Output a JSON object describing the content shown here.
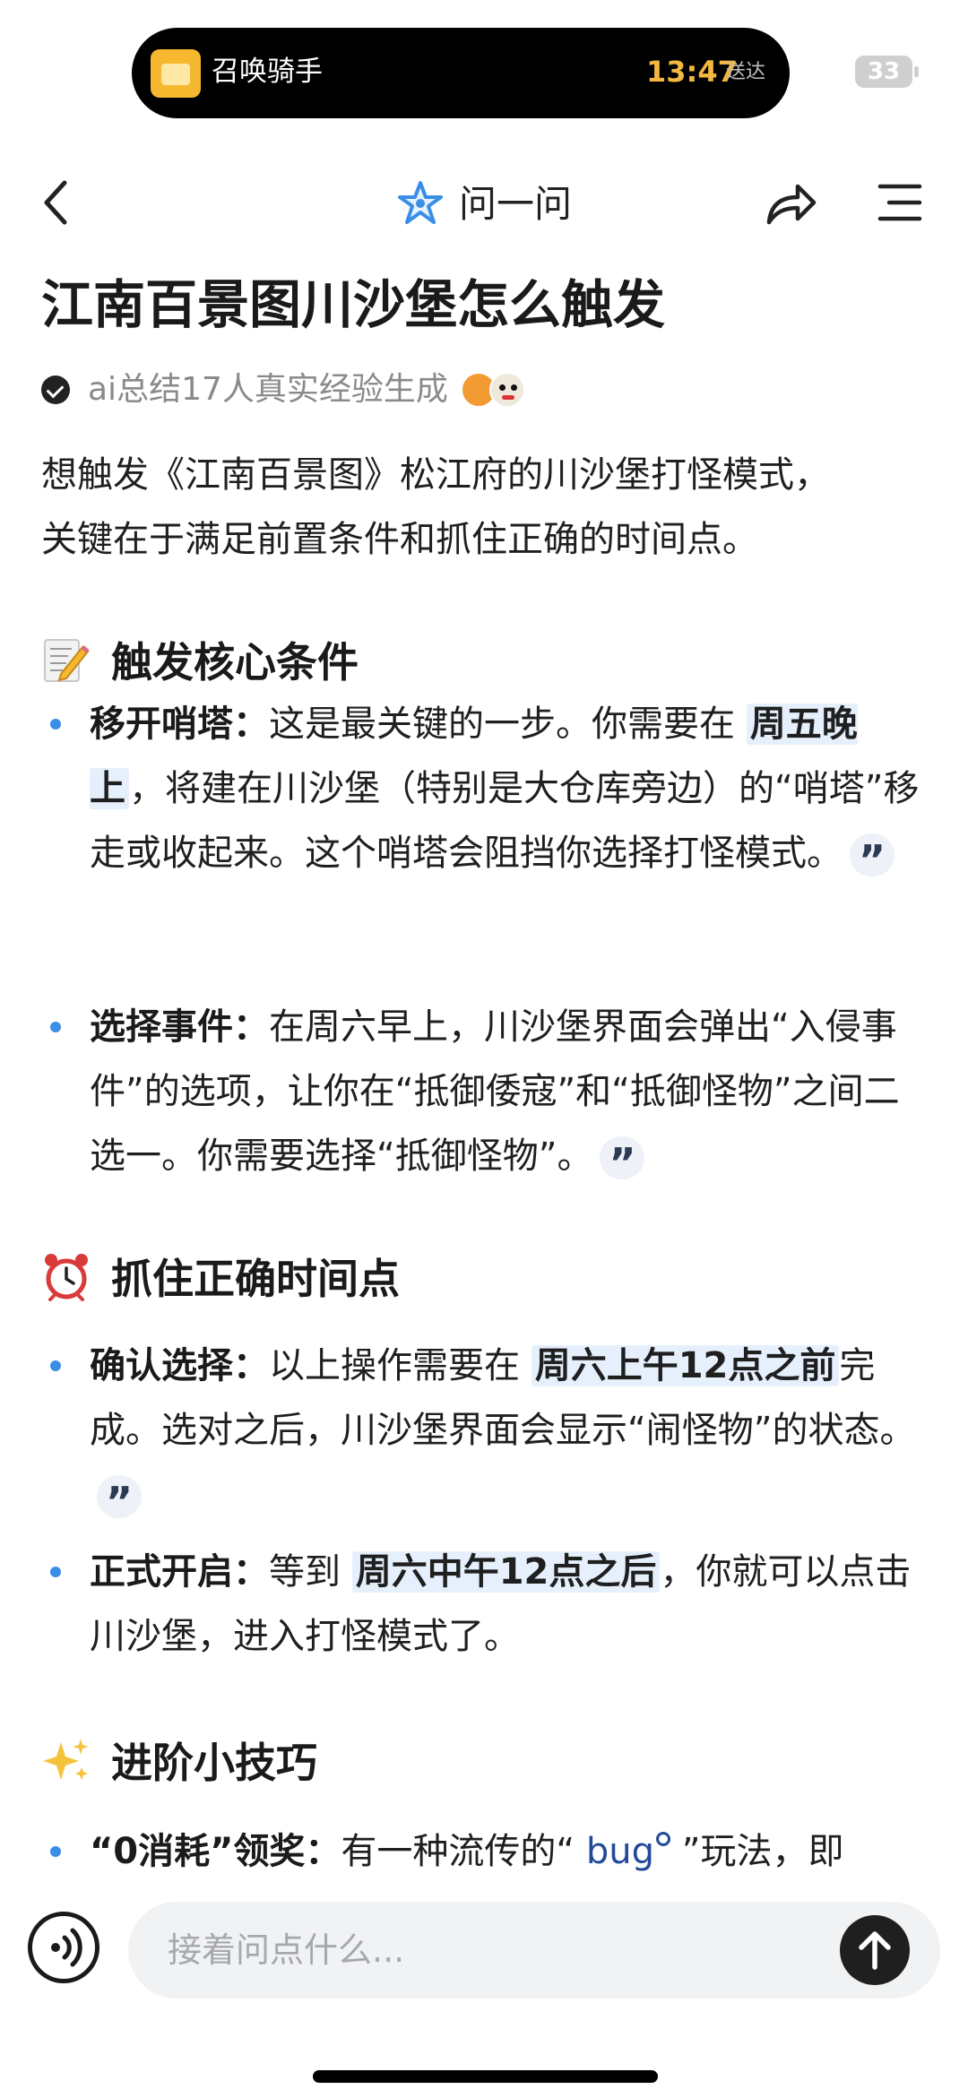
{
  "status_bar": {
    "app_name": "召唤骑手",
    "time": "13:47",
    "sub_label": "送达",
    "battery": "33"
  },
  "nav": {
    "title": "问一问"
  },
  "article": {
    "title": "江南百景图川沙堡怎么触发",
    "meta": "ai总结17人真实经验生成",
    "intro_line1": "想触发《江南百景图》松江府的川沙堡打怪模式，",
    "intro_line2": "关键在于满足前置条件和抓住正确的时间点。",
    "sections": [
      {
        "heading": "触发核心条件",
        "items": [
          {
            "label": "移开哨塔：",
            "text_before": "这是最关键的一步。你需要在",
            "highlight": "周五晚上",
            "text_after": "，将建在川沙堡（特别是大仓库旁边）的“哨塔”移走或收起来。这个哨塔会阻挡你选择打怪模式。"
          },
          {
            "label": "选择事件：",
            "text": "在周六早上，川沙堡界面会弹出“入侵事件”的选项，让你在“抵御倭寇”和“抵御怪物”之间二选一。你需要选择“抵御怪物”。"
          }
        ]
      },
      {
        "heading": "抓住正确时间点",
        "items": [
          {
            "label": "确认选择：",
            "text_before": "以上操作需要在",
            "highlight": "周六上午12点之前",
            "text_after": "完成。选对之后，川沙堡界面会显示“闹怪物”的状态。"
          },
          {
            "label": "正式开启：",
            "text_before": "等到",
            "highlight": "周六中午12点之后",
            "text_after": "，你就可以点击川沙堡，进入打怪模式了。"
          }
        ]
      },
      {
        "heading": "进阶小技巧",
        "items": [
          {
            "label": "“0消耗”领奖：",
            "text_before": "有一种流传的“",
            "link": "bug",
            "text_after": "”玩法，即"
          }
        ]
      }
    ]
  },
  "composer": {
    "placeholder": "接着问点什么..."
  },
  "colors": {
    "accent_blue": "#3a8ee6",
    "highlight_bg": "#e5f0fc",
    "island_time": "#f4b740"
  }
}
